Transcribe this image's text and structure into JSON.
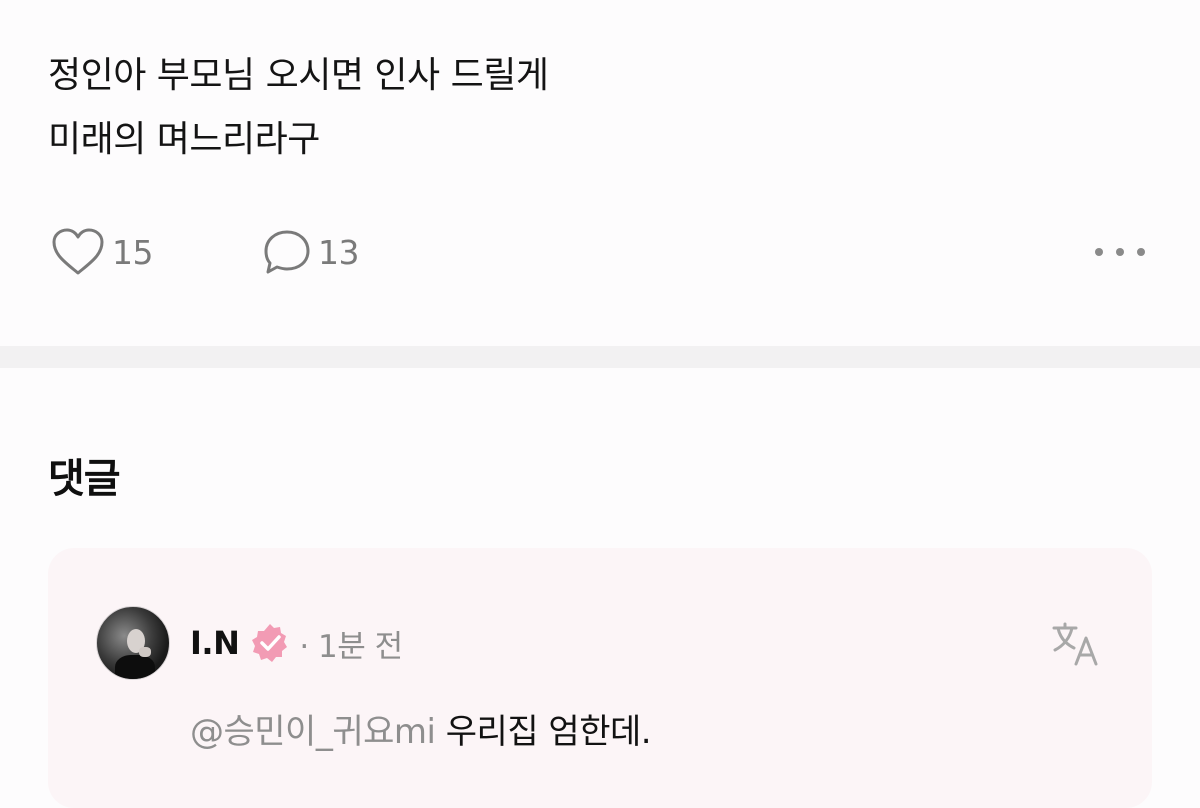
{
  "post": {
    "lines": [
      "정인아 부모님 오시면 인사 드릴게",
      "미래의 며느리라구"
    ],
    "likes": "15",
    "comments": "13"
  },
  "comments_section": {
    "title": "댓글",
    "items": [
      {
        "author": "I.N",
        "verified": true,
        "meta": "· 1분 전",
        "mention": "@승민이_귀요mi",
        "text": "우리집 엄한데."
      }
    ]
  },
  "icons": {
    "like": "heart-outline-icon",
    "comment": "speech-bubble-icon",
    "more": "more-horizontal-icon",
    "verified": "verified-badge-icon",
    "translate": "translate-icon"
  },
  "colors": {
    "background": "#fdfcfd",
    "card": "#fcf5f7",
    "badge": "#f29bb4",
    "muted": "#8e8e8e"
  }
}
